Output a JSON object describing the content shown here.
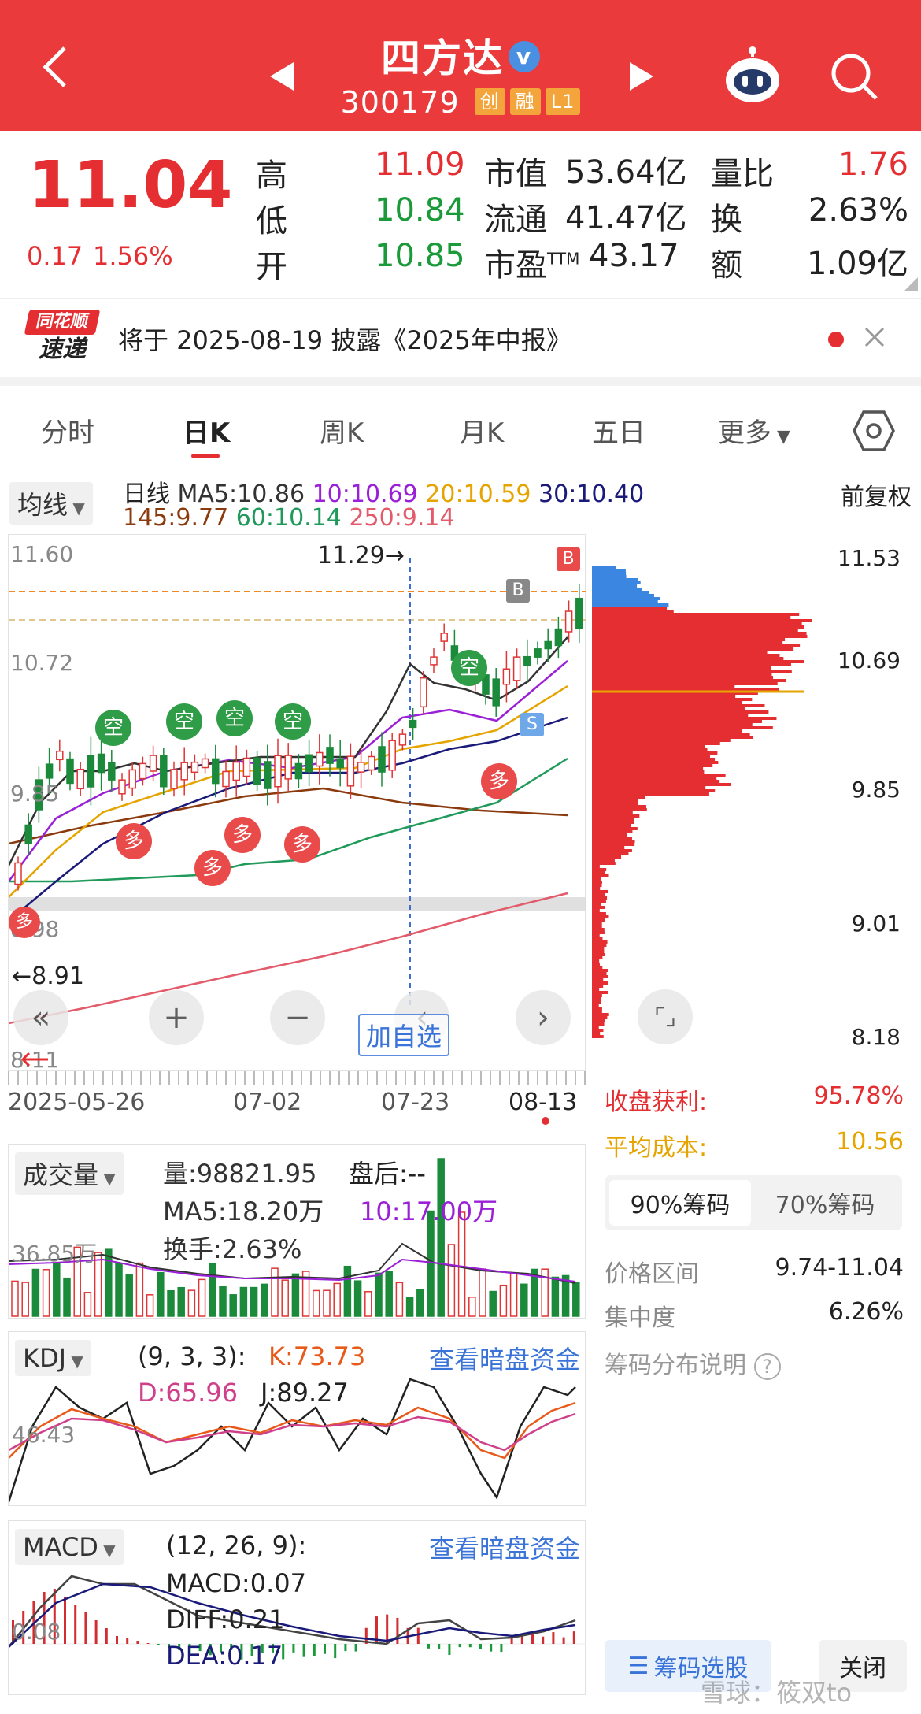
{
  "header": {
    "title": "四方达",
    "verified_mark": "v",
    "code": "300179",
    "tags": [
      "创",
      "融",
      "L1"
    ],
    "colors": {
      "bg": "#ea3a3c",
      "tag": "#f3a53c"
    }
  },
  "quote": {
    "price": "11.04",
    "change": "0.17",
    "change_pct": "1.56%",
    "high_label": "高",
    "high": "11.09",
    "low_label": "低",
    "low": "10.84",
    "open_label": "开",
    "open": "10.85",
    "mktcap_label": "市值",
    "mktcap": "53.64亿",
    "float_label": "流通",
    "float": "41.47亿",
    "pe_label": "市盈",
    "pe_sup": "TTM",
    "pe": "43.17",
    "vol_ratio_label": "量比",
    "vol_ratio": "1.76",
    "turnover_label": "换",
    "turnover": "2.63%",
    "amount_label": "额",
    "amount": "1.09亿"
  },
  "notice": {
    "logo_top": "同花顺",
    "logo_bottom": "速递",
    "text": "将于 2025-08-19 披露《2025年中报》"
  },
  "tabs": [
    "分时",
    "日K",
    "周K",
    "月K",
    "五日",
    "更多"
  ],
  "active_tab": "日K",
  "ma": {
    "dropdown": "均线",
    "period": "日线",
    "ma5": "MA5:10.86",
    "ma10": "10:10.69",
    "ma20": "20:10.59",
    "ma30": "30:10.40",
    "ma145": "145:9.77",
    "ma60": "60:10.14",
    "ma250": "250:9.14",
    "adjust": "前复权",
    "colors": {
      "ma5": "#333333",
      "ma10": "#9a1fd6",
      "ma20": "#e6a400",
      "ma30": "#1a1a7a",
      "ma145": "#8b3a0e",
      "ma60": "#1f9a5a",
      "ma250": "#e35a6a"
    }
  },
  "kchart": {
    "y_labels": [
      "11.60",
      "10.72",
      "9.85",
      "8.98",
      "8.11"
    ],
    "high_marker": "11.29→",
    "low_marker": "←8.91",
    "x_labels": [
      "2025-05-26",
      "07-02",
      "07-23",
      "08-13"
    ],
    "signal_kong": "空",
    "signal_duo": "多",
    "signal_b": "B",
    "signal_s": "S",
    "add_watch": "加自选"
  },
  "chips": {
    "y_labels": [
      "11.53",
      "10.69",
      "9.85",
      "9.01",
      "8.18"
    ],
    "profit_label": "收盘获利:",
    "profit": "95.78%",
    "cost_label": "平均成本:",
    "cost": "10.56",
    "tab90": "90%筹码",
    "tab70": "70%筹码",
    "range_label": "价格区间",
    "range": "9.74-11.04",
    "conc_label": "集中度",
    "conc": "6.26%",
    "help": "筹码分布说明",
    "select_btn": "筹码选股",
    "close_btn": "关闭"
  },
  "volume": {
    "dropdown": "成交量",
    "vol": "量:98821.95",
    "after": "盘后:--",
    "ma5": "MA5:18.20万",
    "ma10": "10:17.00万",
    "turnover": "换手:2.63%",
    "axis": "36.85万"
  },
  "kdj": {
    "dropdown": "KDJ",
    "params": "(9, 3, 3):",
    "k": "K:73.73",
    "d": "D:65.96",
    "j": "J:89.27",
    "link": "查看暗盘资金",
    "axis": "46.43"
  },
  "macd": {
    "dropdown": "MACD",
    "params": "(12, 26, 9):",
    "macd": "MACD:0.07",
    "diff": "DIFF:0.21",
    "dea": "DEA:0.17",
    "link": "查看暗盘资金",
    "axis": "0.08"
  },
  "watermark": "雪球：筱双to"
}
